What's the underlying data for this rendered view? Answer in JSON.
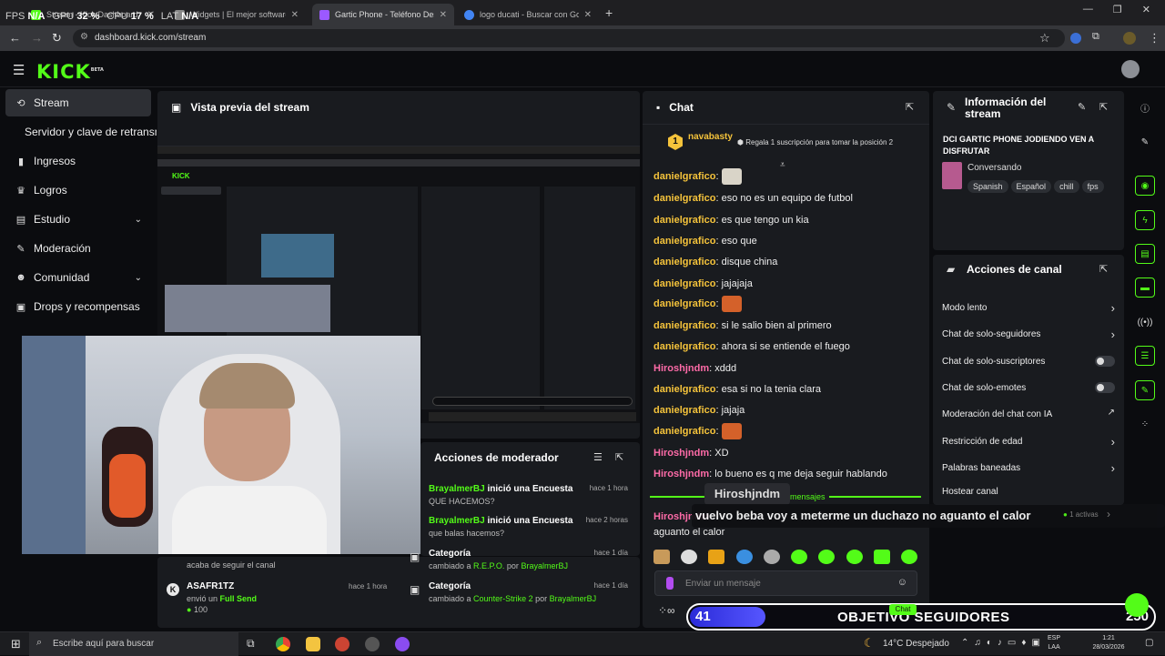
{
  "overlay": {
    "fps_label": "FPS",
    "fps_value": "N/A",
    "gpu_label": "GPU",
    "gpu_value": "32 %",
    "cpu_label": "CPU",
    "cpu_value": "17 %",
    "lat_label": "LAT",
    "lat_value": "N/A"
  },
  "browser": {
    "tabs": [
      {
        "title": "Stream - Kick Dashboard",
        "color": "#53fc18"
      },
      {
        "title": "Widgets | El mejor software para",
        "color": "#888888"
      },
      {
        "title": "Gartic Phone - Teléfono Descom",
        "color": "#9b59ff",
        "active": true
      },
      {
        "title": "logo ducati - Buscar con Google",
        "color": "#4285f4"
      }
    ],
    "new_tab": "+",
    "url": "dashboard.kick.com/stream",
    "min": "—",
    "max": "❐",
    "close": "✕"
  },
  "kick": {
    "logo": "KICK",
    "logo_beta": "BETA"
  },
  "sidebar": {
    "items": [
      {
        "label": "Stream",
        "icon": "stream-icon"
      },
      {
        "label": "Servidor y clave de retransmisión",
        "icon": ""
      },
      {
        "label": "Ingresos",
        "icon": "chart-icon"
      },
      {
        "label": "Logros",
        "icon": "trophy-icon"
      },
      {
        "label": "Estudio",
        "icon": "studio-icon"
      },
      {
        "label": "Moderación",
        "icon": "wrench-icon"
      },
      {
        "label": "Comunidad",
        "icon": "community-icon"
      },
      {
        "label": "Drops y recompensas",
        "icon": "drops-icon"
      }
    ]
  },
  "preview": {
    "title": "Vista previa del stream"
  },
  "chat": {
    "title": "Chat",
    "pinned_user": "navabasty",
    "pinned_rank": "1",
    "pinned_text": "Regala 1 suscripción para tomar la posición 2",
    "messages": [
      {
        "user": "danielgrafico",
        "text": "",
        "emote": true,
        "color": "yellow"
      },
      {
        "user": "danielgrafico",
        "text": "eso no es un equipo de futbol",
        "color": "yellow"
      },
      {
        "user": "danielgrafico",
        "text": "es que tengo un kia",
        "color": "yellow"
      },
      {
        "user": "danielgrafico",
        "text": "eso que",
        "color": "yellow"
      },
      {
        "user": "danielgrafico",
        "text": "disque china",
        "color": "yellow"
      },
      {
        "user": "danielgrafico",
        "text": "jajajaja",
        "color": "yellow"
      },
      {
        "user": "danielgrafico",
        "text": "",
        "emote": true,
        "color": "yellow"
      },
      {
        "user": "danielgrafico",
        "text": "si le salio bien al primero",
        "color": "yellow"
      },
      {
        "user": "danielgrafico",
        "text": "ahora si se entiende el fuego",
        "color": "yellow"
      },
      {
        "user": "Hiroshjndm",
        "text": "xddd",
        "color": "pink"
      },
      {
        "user": "danielgrafico",
        "text": "esa si no la tenia clara",
        "color": "yellow"
      },
      {
        "user": "danielgrafico",
        "text": "jajaja",
        "color": "yellow"
      },
      {
        "user": "danielgrafico",
        "text": "",
        "emote": true,
        "color": "yellow"
      },
      {
        "user": "Hiroshjndm",
        "text": "XD",
        "color": "pink"
      },
      {
        "user": "Hiroshjndm",
        "text": "lo bueno es q me deja seguir hablando",
        "color": "pink"
      }
    ],
    "new_messages": "mensajes",
    "last_user": "Hiroshjndm",
    "last_text_cont": "aguanto el calor",
    "input_placeholder": "Enviar un mensaje",
    "send_label": "Chat"
  },
  "highlight": {
    "user": "Hiroshjndm",
    "text": "vuelvo beba voy a meterme un duchazo no aguanto el calor",
    "active": "1 activas"
  },
  "stream_info": {
    "title": "Información del stream",
    "stream_title": "DCI GARTIC PHONE JODIENDO VEN A DISFRUTAR",
    "category": "Conversando",
    "tags": [
      "Spanish",
      "Español",
      "chill",
      "fps"
    ]
  },
  "channel_actions": {
    "title": "Acciones de canal",
    "items": [
      {
        "label": "Modo lento",
        "type": "chevron"
      },
      {
        "label": "Chat de solo-seguidores",
        "type": "chevron"
      },
      {
        "label": "Chat de solo-suscriptores",
        "type": "toggle"
      },
      {
        "label": "Chat de solo-emotes",
        "type": "toggle"
      },
      {
        "label": "Moderación del chat con IA",
        "type": "external"
      },
      {
        "label": "Restricción de edad",
        "type": "chevron"
      },
      {
        "label": "Palabras baneadas",
        "type": "chevron"
      },
      {
        "label": "Hostear canal",
        "type": "none"
      }
    ]
  },
  "mod_actions": {
    "title": "Acciones de moderador",
    "rows": [
      {
        "user": "BrayalmerBJ",
        "action": "inició una Encuesta",
        "sub": "QUE HACEMOS?",
        "time": "hace 1 hora"
      },
      {
        "user": "BrayalmerBJ",
        "action": "inició una Encuesta",
        "sub": "que balas hacemos?",
        "time": "hace 2 horas"
      },
      {
        "user": "Categoría",
        "action": "",
        "sub_pre": "cambiado a",
        "sub_game": "R.E.P.O.",
        "sub_by": "por",
        "sub_user": "BrayalmerBJ",
        "time": "hace 1 día"
      },
      {
        "user": "Categoría",
        "action": "",
        "sub_pre": "cambiado a",
        "sub_game": "Counter-Strike 2",
        "sub_by": "por",
        "sub_user": "BrayalmerBJ",
        "time": "hace 1 día"
      }
    ]
  },
  "activity": {
    "prev_text": "acaba de seguir el canal",
    "user": "ASAFR1TZ",
    "time": "hace 1 hora",
    "action_pre": "envió un",
    "action_item": "Full Send",
    "amount": "100"
  },
  "goal": {
    "current": "41",
    "label": "OBJETIVO SEGUIDORES",
    "target": "250",
    "progress": 0.164
  },
  "taskbar": {
    "search": "Escribe aquí para buscar",
    "weather": "14°C  Despejado",
    "lang": "ESP",
    "lang2": "LAA",
    "time": "1:21",
    "date": "28/03/2026"
  }
}
